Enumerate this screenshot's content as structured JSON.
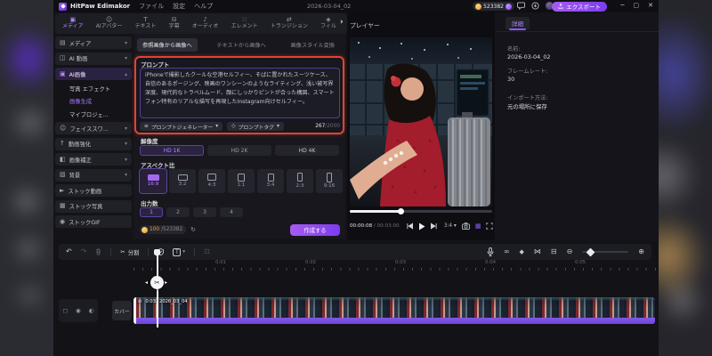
{
  "window": {
    "app_name": "HitPaw Edimakor",
    "menu_file": "ファイル",
    "menu_settings": "設定",
    "menu_help": "ヘルプ",
    "document_title": "2026-03-04_02",
    "credits": "523382",
    "export_label": "エクスポート"
  },
  "ribbon": {
    "media": "メディア",
    "avatar": "AIアバター",
    "text": "テキスト",
    "subtitle": "字幕",
    "audio": "オーディオ",
    "element": "エレメント",
    "transition": "トランジション",
    "filter": "フィル"
  },
  "sidebar": {
    "media": "メディア",
    "ai_video": "AI 動画",
    "ai_image": "AI画像",
    "photo_effects": "写真 エフェクト",
    "image_generation": "画像生成",
    "my_projects": "マイプロジェ...",
    "face_swap": "フェイススワ...",
    "video_enhance": "動画強化",
    "image_correction": "画像補正",
    "background": "背景",
    "stock_video": "ストック動画",
    "stock_photo": "ストック写真",
    "stock_gif": "ストックGIF"
  },
  "generator": {
    "tab_reference": "参照画像から画像へ",
    "tab_text_to_image": "テキストから画像へ",
    "tab_style_transfer": "画像スタイル変換",
    "prompt_label": "プロンプト",
    "prompt_text": "iPhoneで撮影したクールな空港セルフィー、そばに置かれたスーツケース、自信のあるポージング、映画のワンシーンのようなライティング、浅い被写界深度、現代的なトラベルムード、顔にしっかりピントが合った構図、スマートフォン特有のリアルな描写を再現したInstagram向けセルフィー。",
    "prompt_generator_label": "プロンプトジェネレーター",
    "prompt_tags_label": "プロンプトタグ",
    "char_count": "267",
    "char_limit": "/2000",
    "resolution_label": "解像度",
    "resolutions": [
      "HD 1K",
      "HD 2K",
      "HD 4K"
    ],
    "aspect_label": "アスペクト比",
    "aspects": [
      "16:9",
      "3:2",
      "4:3",
      "1:1",
      "3:4",
      "2:3",
      "9:16"
    ],
    "output_label": "出力数",
    "outputs": [
      "1",
      "2",
      "3",
      "4"
    ],
    "cost": "100",
    "balance": "/523382",
    "create_label": "作成する"
  },
  "player": {
    "title": "プレイヤー",
    "current_time": "00:00:08",
    "time_separator": " / ",
    "duration": "00:03:00",
    "ratio": "3:4"
  },
  "details": {
    "tab_label": "詳細",
    "name_label": "名前:",
    "name_value": "2026-03-04_02",
    "framerate_label": "フレームレート:",
    "framerate_value": "30",
    "import_label": "インポート方法:",
    "import_value": "元の場所に保存"
  },
  "timeline": {
    "split_label": "分割",
    "ruler": [
      "0:01",
      "0:02",
      "0:03",
      "0:04",
      "0:05"
    ],
    "cover_label": "カバー",
    "clip_duration": "0:03",
    "clip_name": "2026_03_04"
  },
  "colors": {
    "accent_purple": "#8b5cf6",
    "annotation_red": "#df4434",
    "coin_orange": "#e8a33d"
  }
}
